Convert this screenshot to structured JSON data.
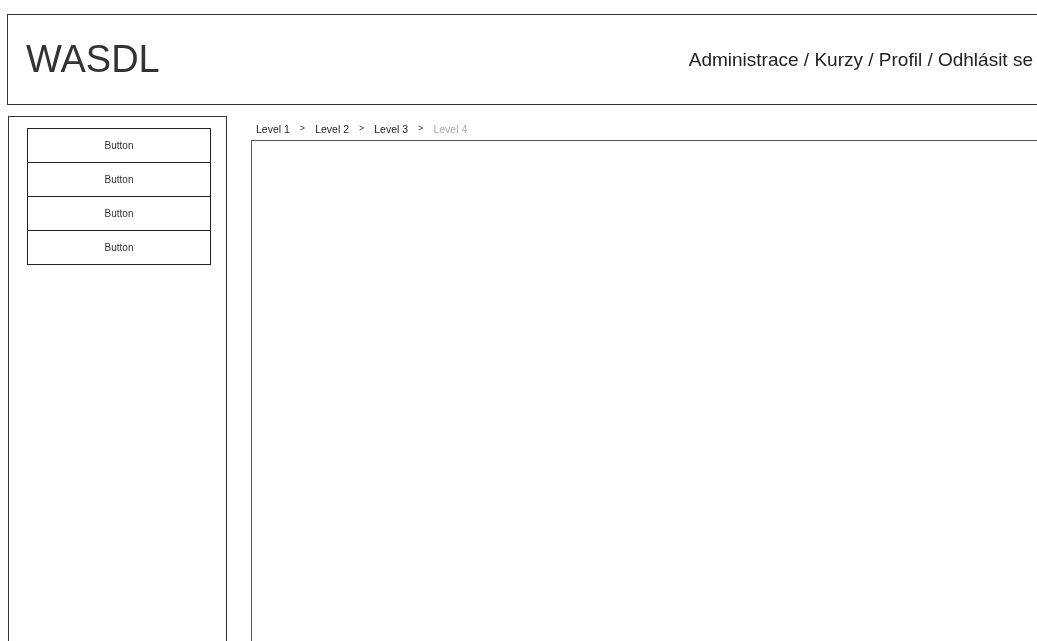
{
  "header": {
    "title": "WASDL",
    "nav": "Administrace / Kurzy / Profil / Odhlásit se"
  },
  "sidebar": {
    "buttons": [
      "Button",
      "Button",
      "Button",
      "Button"
    ]
  },
  "breadcrumb": [
    {
      "label": "Level 1",
      "separator": ">",
      "current": false
    },
    {
      "label": "Level 2",
      "separator": ">",
      "current": false
    },
    {
      "label": "Level 3",
      "separator": ">",
      "current": false
    },
    {
      "label": "Level 4",
      "current": true
    }
  ]
}
